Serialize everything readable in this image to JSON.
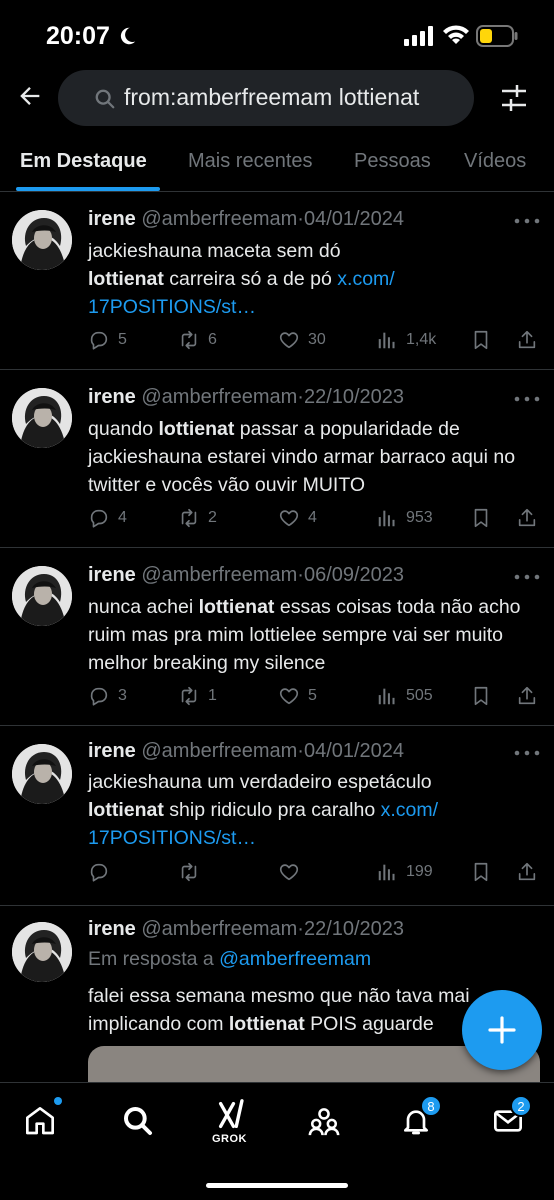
{
  "status_bar": {
    "time": "20:07"
  },
  "search": {
    "query": "from:amberfreemam lottienat"
  },
  "tabs": [
    {
      "label": "Em Destaque",
      "active": true
    },
    {
      "label": "Mais recentes",
      "active": false
    },
    {
      "label": "Pessoas",
      "active": false
    },
    {
      "label": "Vídeos",
      "active": false
    }
  ],
  "tweets": [
    {
      "name": "irene",
      "handle": "@amberfreemam",
      "sep": "·",
      "date": "04/01/2024",
      "text_parts": [
        "jackieshauna maceta sem dó ",
        "lottienat",
        " carreira só a de pó ",
        "x.com/",
        "17POSITIONS/st…"
      ],
      "replies": "5",
      "reposts": "6",
      "likes": "30",
      "views": "1,4k"
    },
    {
      "name": "irene",
      "handle": "@amberfreemam",
      "sep": "·",
      "date": "22/10/2023",
      "text_parts": [
        "quando ",
        "lottienat",
        " passar a popularidade de jackieshauna estarei vindo armar barraco aqui no twitter e vocês vão ouvir MUITO"
      ],
      "replies": "4",
      "reposts": "2",
      "likes": "4",
      "views": "953"
    },
    {
      "name": "irene",
      "handle": "@amberfreemam",
      "sep": "·",
      "date": "06/09/2023",
      "text_parts": [
        "nunca achei ",
        "lottienat",
        " essas coisas toda não acho ruim mas pra mim lottielee sempre vai ser muito melhor breaking my silence"
      ],
      "replies": "3",
      "reposts": "1",
      "likes": "5",
      "views": "505"
    },
    {
      "name": "irene",
      "handle": "@amberfreemam",
      "sep": "·",
      "date": "04/01/2024",
      "text_parts": [
        "jackieshauna um verdadeiro espetáculo ",
        "lottienat",
        " ship ridiculo pra caralho ",
        "x.com/",
        "17POSITIONS/st…"
      ],
      "replies": "",
      "reposts": "",
      "likes": "",
      "views": "199"
    },
    {
      "name": "irene",
      "handle": "@amberfreemam",
      "sep": "·",
      "date": "22/10/2023",
      "reply_prefix": "Em resposta a ",
      "reply_handle": "@amberfreemam",
      "text_parts": [
        "falei essa semana mesmo que não tava mai",
        "implicando com ",
        "lottienat",
        " POIS aguarde"
      ]
    }
  ],
  "bottom_nav": {
    "grok_label": "GROK",
    "notifications_badge": "8",
    "messages_badge": "2"
  },
  "colors": {
    "accent": "#1d9bf0",
    "background": "#000000",
    "muted": "#71767b"
  }
}
